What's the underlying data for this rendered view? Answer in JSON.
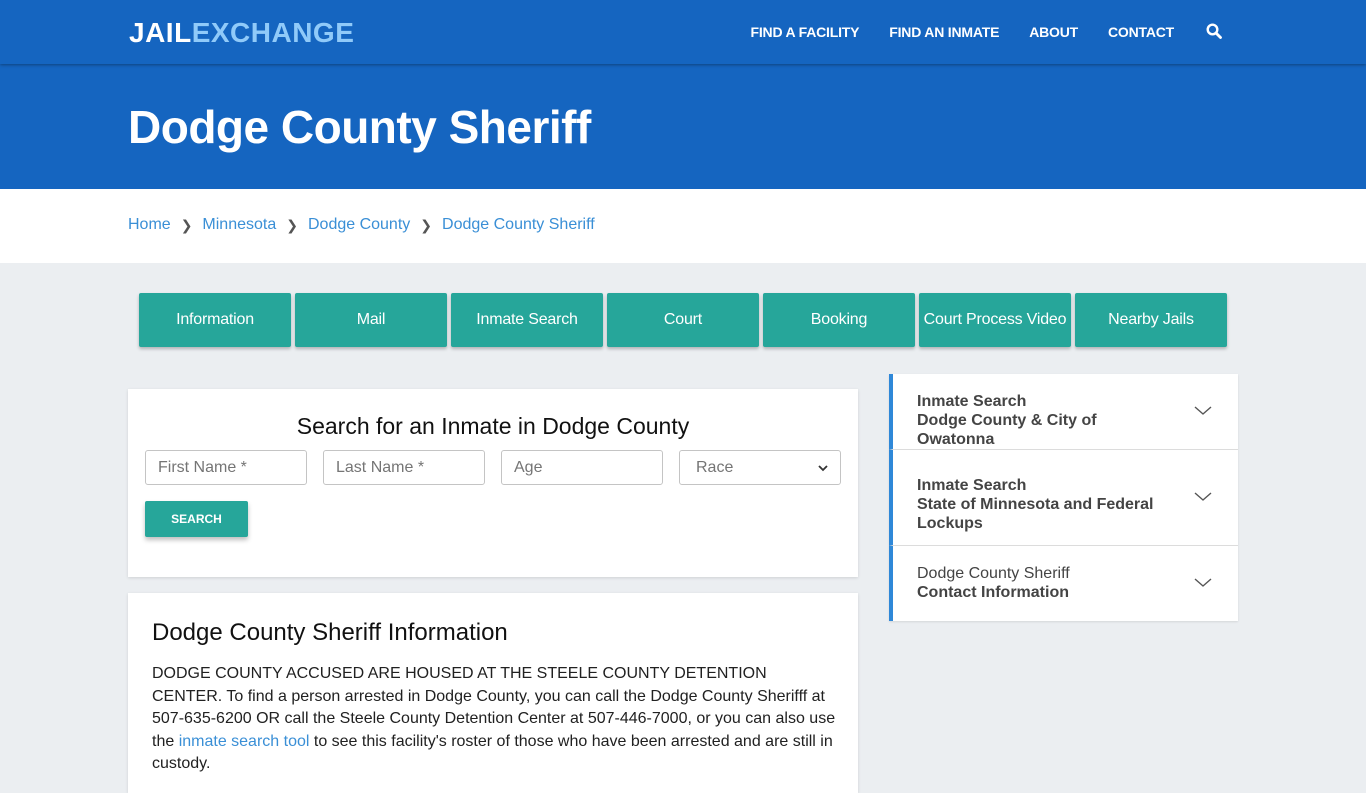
{
  "header": {
    "logo_part1": "JAIL",
    "logo_part2": "EXCHANGE",
    "nav": [
      {
        "label": "FIND A FACILITY"
      },
      {
        "label": "FIND AN INMATE"
      },
      {
        "label": "ABOUT"
      },
      {
        "label": "CONTACT"
      }
    ],
    "search_icon": "search-icon"
  },
  "hero": {
    "title": "Dodge County Sheriff"
  },
  "breadcrumb": [
    {
      "label": "Home"
    },
    {
      "label": "Minnesota"
    },
    {
      "label": "Dodge County"
    },
    {
      "label": "Dodge County Sheriff"
    }
  ],
  "tabs": [
    {
      "label": "Information"
    },
    {
      "label": "Mail"
    },
    {
      "label": "Inmate Search"
    },
    {
      "label": "Court"
    },
    {
      "label": "Booking"
    },
    {
      "label": "Court Process Video"
    },
    {
      "label": "Nearby Jails"
    }
  ],
  "search_form": {
    "title": "Search for an Inmate in Dodge County",
    "first_name_placeholder": "First Name *",
    "last_name_placeholder": "Last Name *",
    "age_placeholder": "Age",
    "race_selected": "Race",
    "submit_label": "SEARCH"
  },
  "info": {
    "title": "Dodge County Sheriff Information",
    "text_before_link": "DODGE COUNTY ACCUSED ARE HOUSED AT THE STEELE COUNTY DETENTION CENTER.  To find a person arrested in Dodge County, you can call the Dodge County Sherifff at 507-635-6200 OR call the Steele County Detention Center at 507-446-7000, or you can also use the ",
    "link_text": "inmate search tool",
    "text_after_link": " to see this facility's roster of those who have been arrested and are still in custody."
  },
  "sidebar": {
    "items": [
      {
        "line1": "Inmate Search",
        "line2": "Dodge County & City of Owatonna"
      },
      {
        "line1": "Inmate Search",
        "line2": "State of Minnesota and Federal Lockups"
      },
      {
        "line1": "Dodge County Sheriff",
        "line2": "Contact Information"
      }
    ]
  },
  "colors": {
    "brand_blue": "#1565c0",
    "logo_accent": "#90caf9",
    "teal": "#26a69a",
    "link_blue": "#3a8fd6",
    "accordion_accent": "#2f88d8",
    "page_bg": "#ebeef1"
  }
}
